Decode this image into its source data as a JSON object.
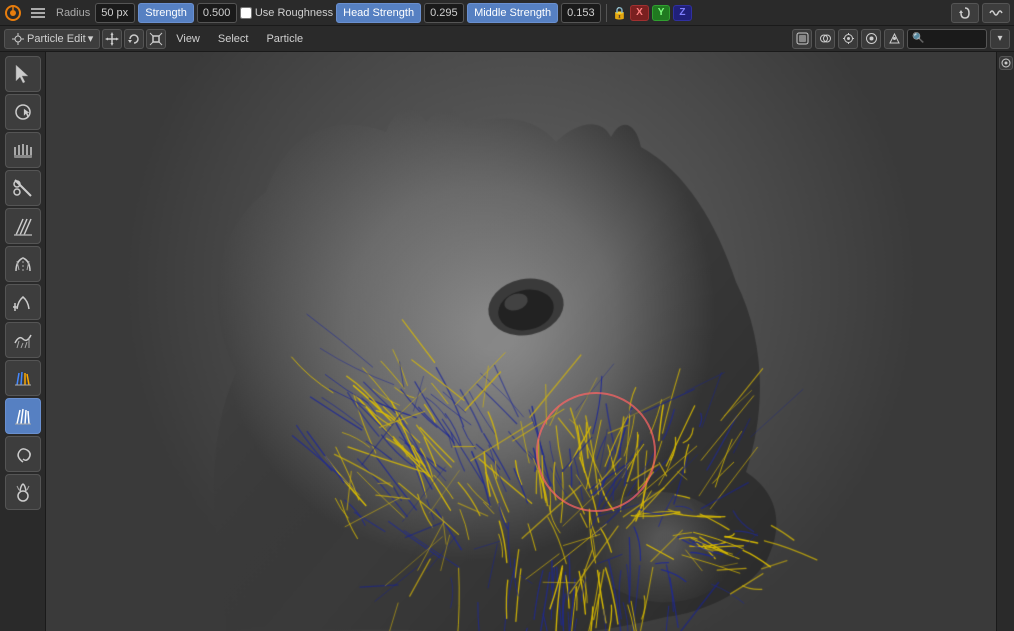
{
  "toolbar": {
    "radius_label": "Radius",
    "radius_value": "50 px",
    "strength_label": "Strength",
    "strength_value": "0.500",
    "use_roughness_label": "Use Roughness",
    "head_strength_label": "Head Strength",
    "head_strength_value": "0.295",
    "middle_strength_label": "Middle Strength",
    "middle_strength_value": "0.153"
  },
  "mode_bar": {
    "mode_label": "Particle Edit",
    "view_label": "View",
    "select_label": "Select",
    "particle_label": "Particle"
  },
  "xyz": {
    "x": "X",
    "y": "Y",
    "z": "Z"
  },
  "tools": [
    {
      "id": "select",
      "icon": "↖",
      "label": "Select"
    },
    {
      "id": "select-circle",
      "icon": "⊙",
      "label": "Select Circle"
    },
    {
      "id": "comb",
      "icon": "≋",
      "label": "Comb"
    },
    {
      "id": "cut",
      "icon": "✂",
      "label": "Cut"
    },
    {
      "id": "length",
      "icon": "⫰",
      "label": "Length"
    },
    {
      "id": "puff",
      "icon": "⟨≈",
      "label": "Puff"
    },
    {
      "id": "add",
      "icon": "⊕",
      "label": "Add"
    },
    {
      "id": "smooth",
      "icon": "∿",
      "label": "Smooth"
    },
    {
      "id": "weight",
      "icon": "≈",
      "label": "Weight"
    },
    {
      "id": "active",
      "icon": "≋",
      "label": "Active",
      "active": true
    },
    {
      "id": "curl",
      "icon": "∫",
      "label": "Curl"
    },
    {
      "id": "shape",
      "icon": "♦",
      "label": "Shape"
    }
  ],
  "viewport_controls": {
    "search_placeholder": "🔍"
  },
  "colors": {
    "active_blue": "#5680c2",
    "background": "#555555",
    "head_color": "#6a6a6a",
    "hair_yellow": "#ddcc00",
    "hair_blue": "#2233aa",
    "brush_red": "rgba(220,80,80,0.7)"
  }
}
